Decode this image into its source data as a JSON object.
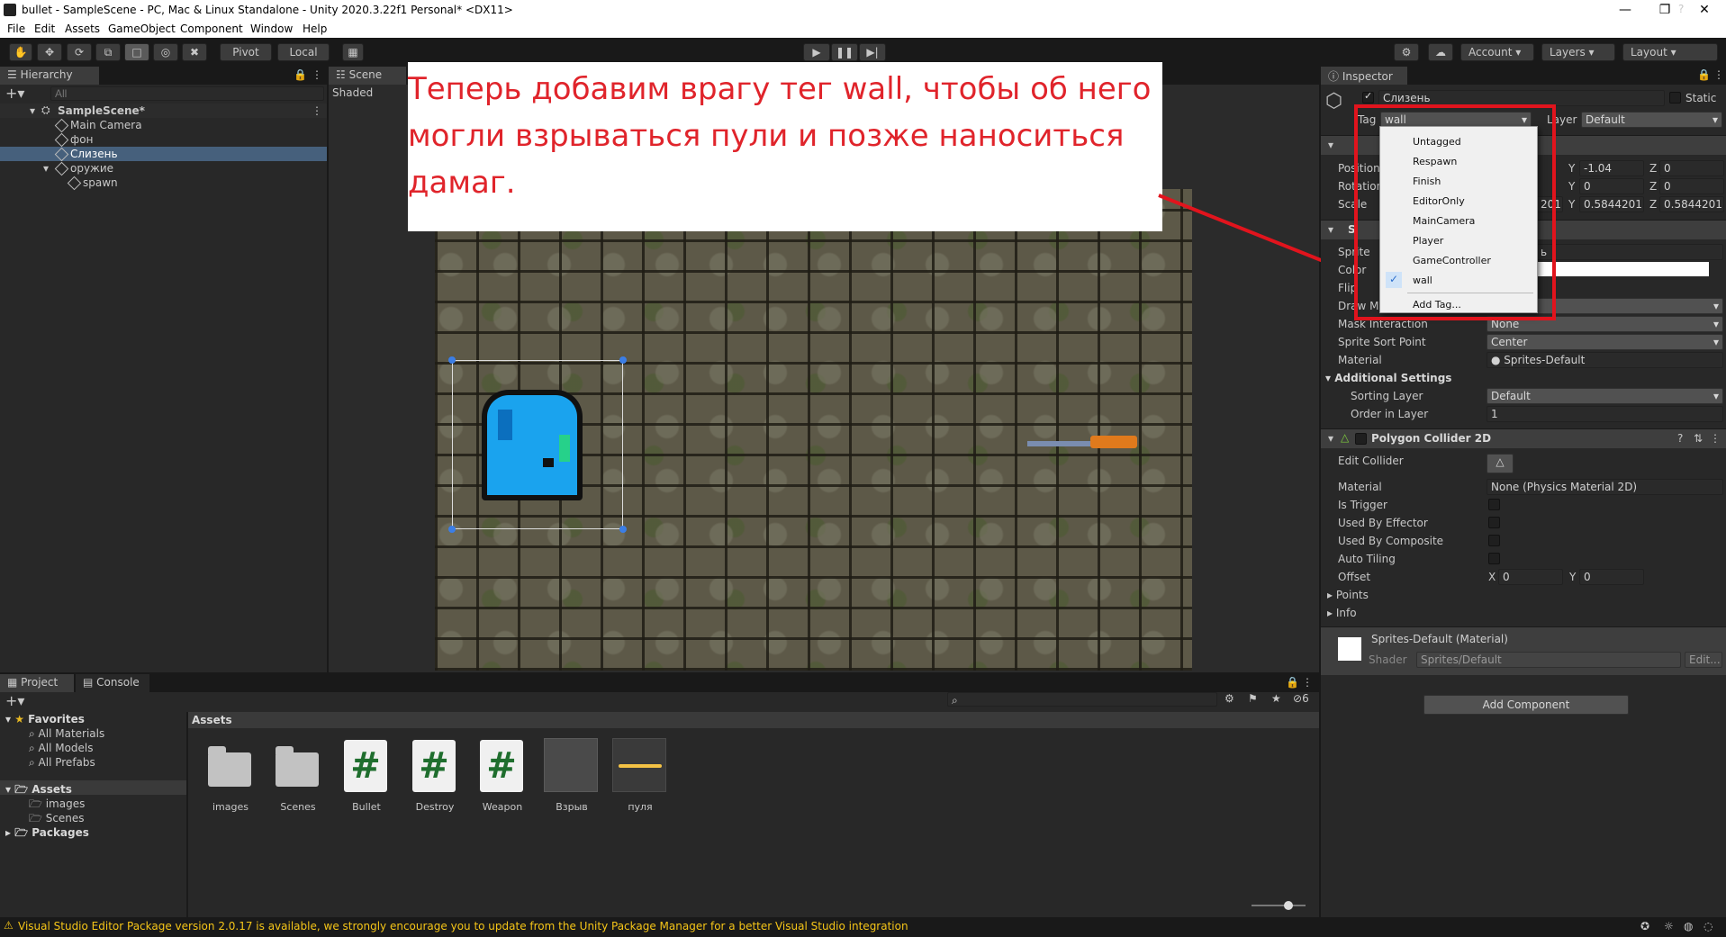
{
  "window": {
    "title": "bullet - SampleScene - PC, Mac & Linux Standalone - Unity 2020.3.22f1 Personal* <DX11>"
  },
  "menu": [
    "File",
    "Edit",
    "Assets",
    "GameObject",
    "Component",
    "Window",
    "Help"
  ],
  "toolbar": {
    "pivot": "Pivot",
    "local": "Local",
    "account": "Account",
    "layers": "Layers",
    "layout": "Layout"
  },
  "hierarchy": {
    "tab": "Hierarchy",
    "search_placeholder": "All",
    "scene": "SampleScene*",
    "items": [
      "Main Camera",
      "фон",
      "Слизень",
      "оружие",
      "spawn"
    ]
  },
  "scene": {
    "tab": "Scene",
    "mode": "Shaded"
  },
  "callout": {
    "text": "Теперь добавим врагу тег wall, чтобы об него могли взрываться пули и позже наноситься дамаг."
  },
  "inspector": {
    "tab": "Inspector",
    "object_name": "Слизень",
    "static": "Static",
    "tag_label": "Tag",
    "tag_value": "wall",
    "layer_label": "Layer",
    "layer_value": "Default",
    "transform": {
      "pos_label": "Position",
      "rot_label": "Rotation",
      "scale_label": "Scale",
      "pos_y": "-1.04",
      "pos_z": "0",
      "rot_y": "0",
      "rot_z": "0",
      "scale_x_partial": "201",
      "scale_y": "0.5844201",
      "scale_z": "0.5844201"
    },
    "sprite_renderer": {
      "title_partial": "S",
      "sprite_label": "Sprite",
      "sprite_partial": "ь",
      "color_label": "Color",
      "flip_label": "Flip",
      "draw_label": "Draw Mo",
      "mask_label": "Mask Interaction",
      "mask_value": "None",
      "sort_point_label": "Sprite Sort Point",
      "sort_point_value": "Center",
      "material_label": "Material",
      "material_value": "Sprites-Default",
      "additional": "Additional Settings",
      "sorting_layer_label": "Sorting Layer",
      "sorting_layer_value": "Default",
      "order_label": "Order in Layer",
      "order_value": "1"
    },
    "polygon": {
      "title": "Polygon Collider 2D",
      "edit_collider": "Edit Collider",
      "material_label": "Material",
      "material_value": "None (Physics Material 2D)",
      "is_trigger": "Is Trigger",
      "by_effector": "Used By Effector",
      "by_composite": "Used By Composite",
      "auto_tiling": "Auto Tiling",
      "offset": "Offset",
      "offset_x": "0",
      "offset_y": "0",
      "points": "Points",
      "info": "Info"
    },
    "material": {
      "name": "Sprites-Default (Material)",
      "shader_label": "Shader",
      "shader_value": "Sprites/Default",
      "edit": "Edit..."
    },
    "add_component": "Add Component"
  },
  "tag_dropdown": {
    "items": [
      "Untagged",
      "Respawn",
      "Finish",
      "EditorOnly",
      "MainCamera",
      "Player",
      "GameController",
      "wall"
    ],
    "selected": "wall",
    "add_tag": "Add Tag..."
  },
  "project": {
    "tabs": [
      "Project",
      "Console"
    ],
    "favorites": "Favorites",
    "fav_items": [
      "All Materials",
      "All Models",
      "All Prefabs"
    ],
    "assets_root": "Assets",
    "asset_folders": [
      "images",
      "Scenes"
    ],
    "packages": "Packages",
    "breadcrumb": "Assets",
    "hidden_count": "6",
    "assets": [
      {
        "name": "images",
        "kind": "folder"
      },
      {
        "name": "Scenes",
        "kind": "folder"
      },
      {
        "name": "Bullet",
        "kind": "script"
      },
      {
        "name": "Destroy",
        "kind": "script"
      },
      {
        "name": "Weapon",
        "kind": "script"
      },
      {
        "name": "Взрыв",
        "kind": "sprite"
      },
      {
        "name": "пуля",
        "kind": "sprite"
      }
    ],
    "script_glyph": "#"
  },
  "status": {
    "message": "Visual Studio Editor Package version 2.0.17 is available, we strongly encourage you to update from the Unity Package Manager for a better Visual Studio integration"
  },
  "colors": {
    "accent_red": "#e1141d",
    "selected_row": "#46607c",
    "status_warning": "#f5c518"
  }
}
